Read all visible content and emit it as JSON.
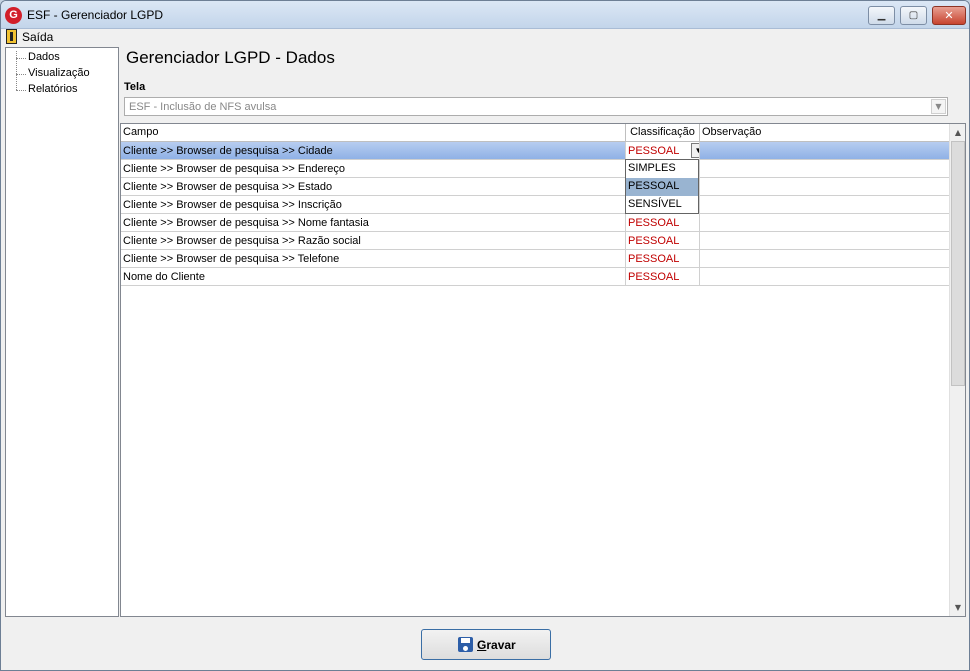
{
  "window": {
    "title": "ESF - Gerenciador LGPD",
    "app_icon_letter": "G",
    "minimize": "▁",
    "maximize": "▢",
    "close": "✕"
  },
  "menu": {
    "exit_label": "Saída"
  },
  "sidebar": {
    "items": [
      {
        "label": "Dados"
      },
      {
        "label": "Visualização"
      },
      {
        "label": "Relatórios"
      }
    ]
  },
  "main": {
    "title": "Gerenciador LGPD - Dados",
    "tela_label": "Tela",
    "tela_value": "ESF - Inclusão de NFS avulsa"
  },
  "grid": {
    "headers": [
      "Campo",
      "Classificação",
      "Observação"
    ],
    "rows": [
      {
        "campo": "Cliente >> Browser de pesquisa >> Cidade",
        "classificacao": "PESSOAL",
        "observacao": ""
      },
      {
        "campo": "Cliente >> Browser de pesquisa >> Endereço",
        "classificacao": "",
        "observacao": ""
      },
      {
        "campo": "Cliente >> Browser de pesquisa >> Estado",
        "classificacao": "",
        "observacao": ""
      },
      {
        "campo": "Cliente >> Browser de pesquisa >> Inscrição",
        "classificacao": "",
        "observacao": ""
      },
      {
        "campo": "Cliente >> Browser de pesquisa >> Nome fantasia",
        "classificacao": "PESSOAL",
        "observacao": ""
      },
      {
        "campo": "Cliente >> Browser de pesquisa >> Razão social",
        "classificacao": "PESSOAL",
        "observacao": ""
      },
      {
        "campo": "Cliente >> Browser de pesquisa >> Telefone",
        "classificacao": "PESSOAL",
        "observacao": ""
      },
      {
        "campo": "Nome do Cliente",
        "classificacao": "PESSOAL",
        "observacao": ""
      }
    ],
    "dropdown_options": [
      "SIMPLES",
      "PESSOAL",
      "SENSÍVEL"
    ],
    "dropdown_highlighted": "PESSOAL"
  },
  "footer": {
    "save_underlined": "G",
    "save_rest": "ravar"
  },
  "colors": {
    "selected_row": "#8fb1e6",
    "classification_text": "#c00000",
    "button_border": "#3a6ea5"
  }
}
